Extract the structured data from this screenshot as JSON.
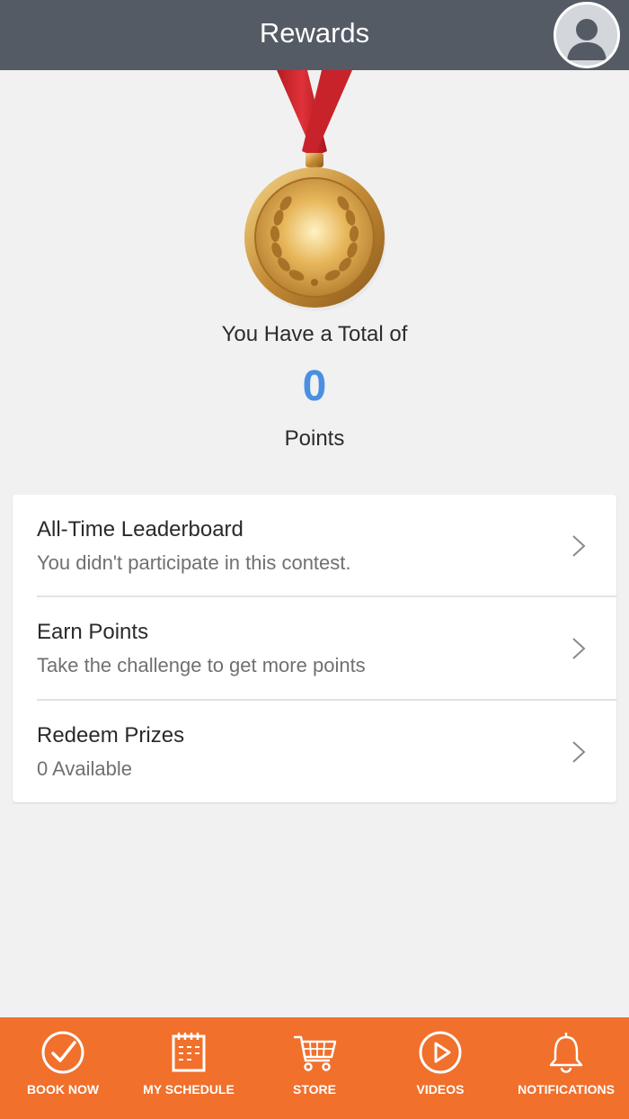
{
  "header": {
    "title": "Rewards",
    "avatar_icon": "user-avatar-icon"
  },
  "summary": {
    "total_label": "You Have a Total of",
    "points_value": "0",
    "points_label": "Points",
    "points_color": "#4a90e2",
    "medal_icon": "gold-medal-icon"
  },
  "menu": {
    "items": [
      {
        "title": "All-Time Leaderboard",
        "subtitle": "You didn't participate in this contest."
      },
      {
        "title": "Earn Points",
        "subtitle": "Take the challenge to get more points"
      },
      {
        "title": "Redeem Prizes",
        "subtitle": "0 Available"
      }
    ]
  },
  "tabbar": {
    "background": "#f0702c",
    "tabs": [
      {
        "label": "BOOK NOW",
        "icon": "check-circle-icon"
      },
      {
        "label": "MY SCHEDULE",
        "icon": "calendar-icon"
      },
      {
        "label": "STORE",
        "icon": "cart-icon"
      },
      {
        "label": "VIDEOS",
        "icon": "play-circle-icon"
      },
      {
        "label": "NOTIFICATIONS",
        "icon": "bell-icon"
      }
    ]
  }
}
